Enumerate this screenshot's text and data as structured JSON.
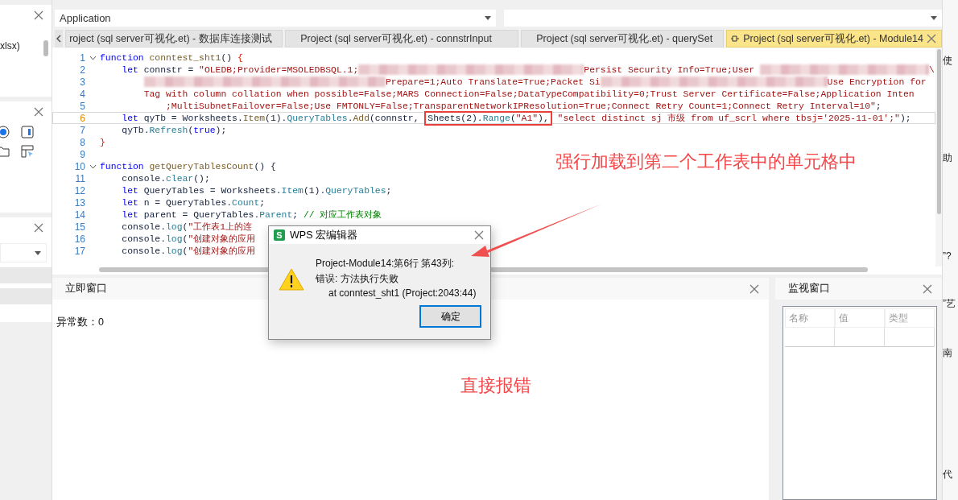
{
  "sidebar": {
    "panels": [
      {
        "kind": "tree",
        "items": [
          "xlsx)"
        ]
      },
      {
        "kind": "tools"
      },
      {
        "kind": "select"
      }
    ]
  },
  "toolbar": {
    "object_select": {
      "value": "Application"
    }
  },
  "tabs": [
    {
      "label": "roject (sql server可视化.et) - 数据库连接测试",
      "selected": false
    },
    {
      "label": "Project (sql server可视化.et) - connstrInput",
      "selected": false
    },
    {
      "label": "Project (sql server可视化.et) - querySet",
      "selected": false
    },
    {
      "label": "Project (sql server可视化.et) - Module14",
      "selected": true
    }
  ],
  "editor": {
    "lines": [
      {
        "number": "1",
        "current": false,
        "foldable": true,
        "tokens": [
          {
            "kind": "kw",
            "text": "function"
          },
          {
            "kind": "fn",
            "text": " conntest_sht1"
          },
          {
            "kind": "p",
            "text": "() "
          },
          {
            "kind": "brace",
            "text": "{"
          }
        ]
      },
      {
        "number": "2",
        "current": false,
        "foldable": false,
        "tokens": [
          {
            "kind": "kw",
            "text": "    let"
          },
          {
            "kind": "p",
            "text": " connstr = "
          },
          {
            "kind": "str",
            "text": "\"OLEDB;Provider=MSOLEDBSQL.1;"
          },
          {
            "kind": "redacted"
          },
          {
            "kind": "str",
            "text": "Persist Security Info=True;User "
          },
          {
            "kind": "redacted"
          },
          {
            "kind": "str",
            "text": "\\"
          }
        ]
      },
      {
        "number": "3",
        "current": false,
        "foldable": false,
        "tokens": [
          {
            "kind": "redacted"
          },
          {
            "kind": "str",
            "text": "Prepare=1;Auto Translate=True;Packet Si"
          },
          {
            "kind": "redacted"
          },
          {
            "kind": "str",
            "text": "Use Encryption for"
          }
        ]
      },
      {
        "number": "4",
        "current": false,
        "foldable": false,
        "tokens": [
          {
            "kind": "str",
            "text": "        Tag with column collation when possible=False;MARS Connection=False;DataTypeCompatibility=0;Trust Server Certificate=False;Application Inten"
          }
        ]
      },
      {
        "number": "5",
        "current": false,
        "foldable": false,
        "tokens": [
          {
            "kind": "str",
            "text": "            ;MultiSubnetFailover=False;Use FMTONLY=False;TransparentNetworkIPResolution=True;Connect Retry Count=1;Connect Retry Interval=10\""
          },
          {
            "kind": "p",
            "text": ";"
          }
        ]
      },
      {
        "number": "6",
        "current": true,
        "foldable": false,
        "tokens": [
          {
            "kind": "kw",
            "text": "    let"
          },
          {
            "kind": "p",
            "text": " qyTb = Worksheets."
          },
          {
            "kind": "fn",
            "text": "Item"
          },
          {
            "kind": "p",
            "text": "(1)."
          },
          {
            "kind": "method",
            "text": "QueryTables"
          },
          {
            "kind": "p",
            "text": "."
          },
          {
            "kind": "fn",
            "text": "Add"
          },
          {
            "kind": "p",
            "text": "(connstr, "
          },
          {
            "kind": "callout",
            "tokens": [
              {
                "kind": "p",
                "text": "Sheets(2)."
              },
              {
                "kind": "method",
                "text": "Range"
              },
              {
                "kind": "p",
                "text": "("
              },
              {
                "kind": "str",
                "text": "\"A1\""
              },
              {
                "kind": "p",
                "text": "),"
              }
            ]
          },
          {
            "kind": "str",
            "text": " \"select distinct sj 市级 from uf_scrl where tbsj='2025-11-01';\""
          },
          {
            "kind": "p",
            "text": ");"
          }
        ]
      },
      {
        "number": "7",
        "current": false,
        "foldable": false,
        "tokens": [
          {
            "kind": "p",
            "text": "    qyTb."
          },
          {
            "kind": "method",
            "text": "Refresh"
          },
          {
            "kind": "p",
            "text": "("
          },
          {
            "kind": "kw",
            "text": "true"
          },
          {
            "kind": "p",
            "text": ");"
          }
        ]
      },
      {
        "number": "8",
        "current": false,
        "foldable": false,
        "tokens": [
          {
            "kind": "brace",
            "text": "}"
          }
        ]
      },
      {
        "number": "9",
        "current": false,
        "foldable": false
      },
      {
        "number": "10",
        "current": false,
        "foldable": true,
        "tokens": [
          {
            "kind": "kw",
            "text": "function"
          },
          {
            "kind": "fn",
            "text": " getQueryTablesCount"
          },
          {
            "kind": "p",
            "text": "() {"
          }
        ]
      },
      {
        "number": "11",
        "current": false,
        "foldable": false,
        "tokens": [
          {
            "kind": "p",
            "text": "    console."
          },
          {
            "kind": "method",
            "text": "clear"
          },
          {
            "kind": "p",
            "text": "();"
          }
        ]
      },
      {
        "number": "12",
        "current": false,
        "foldable": false,
        "tokens": [
          {
            "kind": "kw",
            "text": "    let"
          },
          {
            "kind": "p",
            "text": " QueryTables = Worksheets."
          },
          {
            "kind": "method",
            "text": "Item"
          },
          {
            "kind": "p",
            "text": "(1)."
          },
          {
            "kind": "method",
            "text": "QueryTables"
          },
          {
            "kind": "p",
            "text": ";"
          }
        ]
      },
      {
        "number": "13",
        "current": false,
        "foldable": false,
        "tokens": [
          {
            "kind": "kw",
            "text": "    let"
          },
          {
            "kind": "p",
            "text": " n = QueryTables."
          },
          {
            "kind": "method",
            "text": "Count"
          },
          {
            "kind": "p",
            "text": ";"
          }
        ]
      },
      {
        "number": "14",
        "current": false,
        "foldable": false,
        "tokens": [
          {
            "kind": "kw",
            "text": "    let"
          },
          {
            "kind": "p",
            "text": " parent = QueryTables."
          },
          {
            "kind": "method",
            "text": "Parent"
          },
          {
            "kind": "p",
            "text": "; "
          },
          {
            "kind": "comment",
            "text": "// 对应工作表对象"
          }
        ]
      },
      {
        "number": "15",
        "current": false,
        "foldable": false,
        "tokens": [
          {
            "kind": "p",
            "text": "    console."
          },
          {
            "kind": "method",
            "text": "log"
          },
          {
            "kind": "p",
            "text": "("
          },
          {
            "kind": "str",
            "text": "\"工作表1上的连"
          }
        ]
      },
      {
        "number": "16",
        "current": false,
        "foldable": false,
        "tokens": [
          {
            "kind": "p",
            "text": "    console."
          },
          {
            "kind": "method",
            "text": "log"
          },
          {
            "kind": "p",
            "text": "("
          },
          {
            "kind": "str",
            "text": "\"创建对象的应用"
          }
        ]
      },
      {
        "number": "17",
        "current": false,
        "foldable": false,
        "tokens": [
          {
            "kind": "p",
            "text": "    console."
          },
          {
            "kind": "method",
            "text": "log"
          },
          {
            "kind": "p",
            "text": "("
          },
          {
            "kind": "str",
            "text": "\"创建对象的应用"
          }
        ]
      }
    ]
  },
  "immediate_window": {
    "title": "立即窗口",
    "lines": [
      "异常数：0"
    ]
  },
  "watch_window": {
    "title": "监视窗口",
    "columns": [
      "名称",
      "值",
      "类型"
    ]
  },
  "right_strip": [
    "使",
    "助",
    "”?",
    "”艺",
    "南",
    "代"
  ],
  "dialog": {
    "title": "WPS 宏编辑器",
    "app_icon": "S",
    "message": [
      "Project-Module14:第6行 第43列:",
      "错误: 方法执行失败",
      "at conntest_sht1 (Project:2043:44)"
    ],
    "button": "确定"
  },
  "annotations": [
    {
      "text": "强行加载到第二个工作表中的单元格中"
    },
    {
      "text": "直接报错"
    }
  ]
}
